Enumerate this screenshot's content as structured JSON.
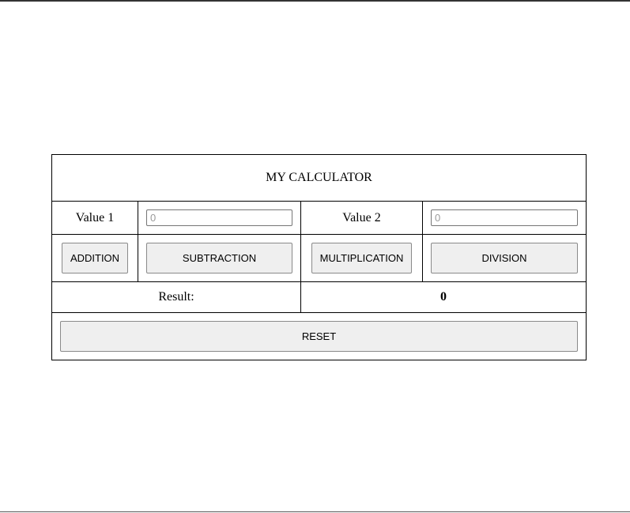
{
  "calculator": {
    "title": "MY CALCULATOR",
    "value1": {
      "label": "Value 1",
      "value": "",
      "placeholder": "0"
    },
    "value2": {
      "label": "Value 2",
      "value": "",
      "placeholder": "0"
    },
    "operations": {
      "addition": "ADDITION",
      "subtraction": "SUBTRACTION",
      "multiplication": "MULTIPLICATION",
      "division": "DIVISION"
    },
    "result": {
      "label": "Result:",
      "value": "0"
    },
    "reset_label": "RESET"
  }
}
